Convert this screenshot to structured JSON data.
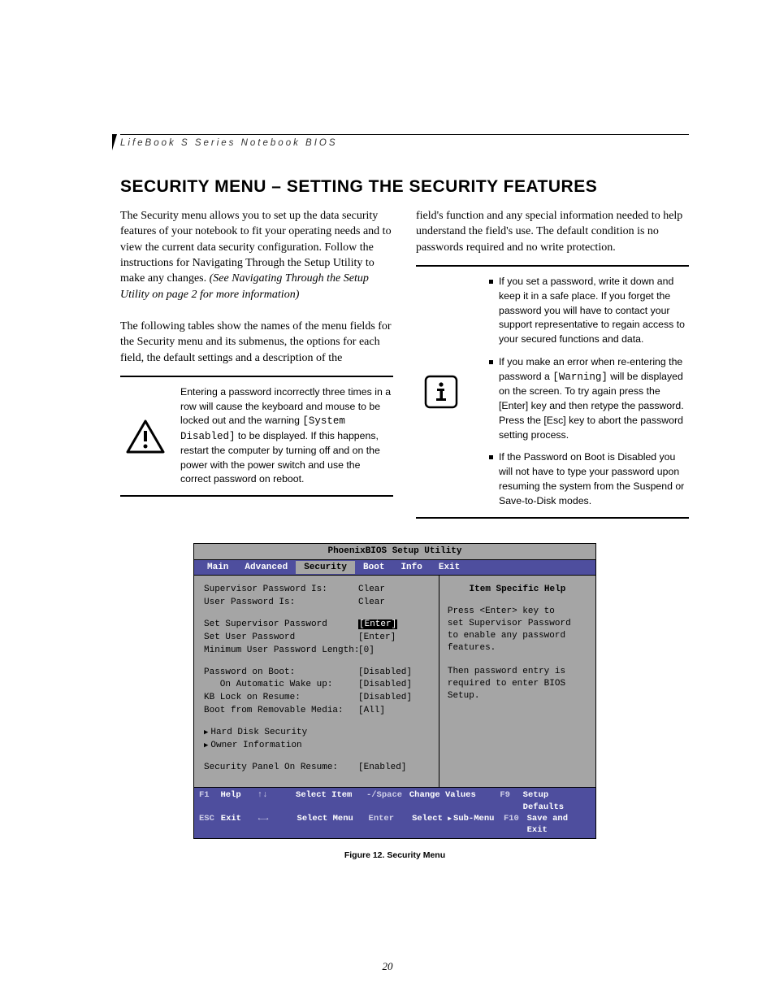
{
  "header": {
    "running_head": "LifeBook S Series Notebook BIOS"
  },
  "title": "SECURITY MENU – SETTING THE SECURITY FEATURES",
  "intro": {
    "p1a": "The Security menu allows you to set up the data security features of your notebook to fit your operating needs and to view the current data security configuration. Follow the instructions for Navigating Through the Setup Utility to make any changes. ",
    "p1b_italic": "(See Navigating Through the Setup Utility on page 2 for more information)",
    "p2": "The following tables show the names of the menu fields for the Security menu and its submenus, the options for each field, the default settings and a description of the",
    "p3": "field's function and any special information needed to help understand the field's use. The default condition is no passwords required and no write protection."
  },
  "warning_box": {
    "text_a": "Entering a password incorrectly three times in a row will cause the keyboard and mouse to be locked out and the warning ",
    "code": "[System Disabled]",
    "text_b": " to be displayed. If this happens, restart the computer by turning off and on the power with the power switch and use the correct password on reboot."
  },
  "info_box": {
    "b1": "If you set a password, write it down and keep it in a safe place. If you forget the password you will have to contact your support representative to regain access to your secured functions and data.",
    "b2a": "If you make an error when re-entering the password a ",
    "b2code": "[Warning]",
    "b2b": " will be displayed on the screen. To try again press the [Enter] key and then retype the password. Press the [Esc] key to abort the password setting process.",
    "b3": "If the Password on Boot is Disabled you will not have to type your password upon resuming the system from the Suspend or Save-to-Disk modes."
  },
  "bios": {
    "title": "PhoenixBIOS Setup Utility",
    "menu": [
      "Main",
      "Advanced",
      "Security",
      "Boot",
      "Info",
      "Exit"
    ],
    "active_menu_index": 2,
    "rows": [
      {
        "label": "Supervisor Password Is:",
        "value": "Clear"
      },
      {
        "label": "User Password Is:",
        "value": "Clear"
      },
      {
        "spacer": true
      },
      {
        "label": "Set Supervisor Password",
        "value": "[Enter]",
        "selected": true
      },
      {
        "label": "Set User Password",
        "value": "[Enter]"
      },
      {
        "label": "Minimum User Password Length:",
        "value": "[0]"
      },
      {
        "spacer": true
      },
      {
        "label": "Password on Boot:",
        "value": "[Disabled]"
      },
      {
        "label": "   On Automatic Wake up:",
        "value": "[Disabled]"
      },
      {
        "label": "KB Lock on Resume:",
        "value": "[Disabled]"
      },
      {
        "label": "Boot from Removable Media:",
        "value": "[All]"
      },
      {
        "spacer": true
      },
      {
        "label": "Hard Disk Security",
        "submenu": true
      },
      {
        "label": "Owner Information",
        "submenu": true
      },
      {
        "spacer": true
      },
      {
        "label": "Security Panel On Resume:",
        "value": "[Enabled]"
      }
    ],
    "help": {
      "title": "Item Specific Help",
      "lines": [
        "Press <Enter> key to",
        "set Supervisor Password",
        "to enable any password",
        "features.",
        "",
        "Then password entry is",
        "required to enter BIOS",
        "Setup."
      ]
    },
    "footer": {
      "r1": {
        "k1": "F1",
        "l1": "Help",
        "k2": "↑↓",
        "l2": "Select Item",
        "k3": "-/Space",
        "l3": "Change Values",
        "k4": "F9",
        "l4": "Setup Defaults"
      },
      "r2": {
        "k1": "ESC",
        "l1": "Exit",
        "k2": "←→",
        "l2": "Select Menu",
        "k3": "Enter",
        "l3": "Select ▶ Sub-Menu",
        "k4": "F10",
        "l4": "Save and Exit"
      }
    }
  },
  "figure_caption": "Figure 12.  Security Menu",
  "page_number": "20"
}
